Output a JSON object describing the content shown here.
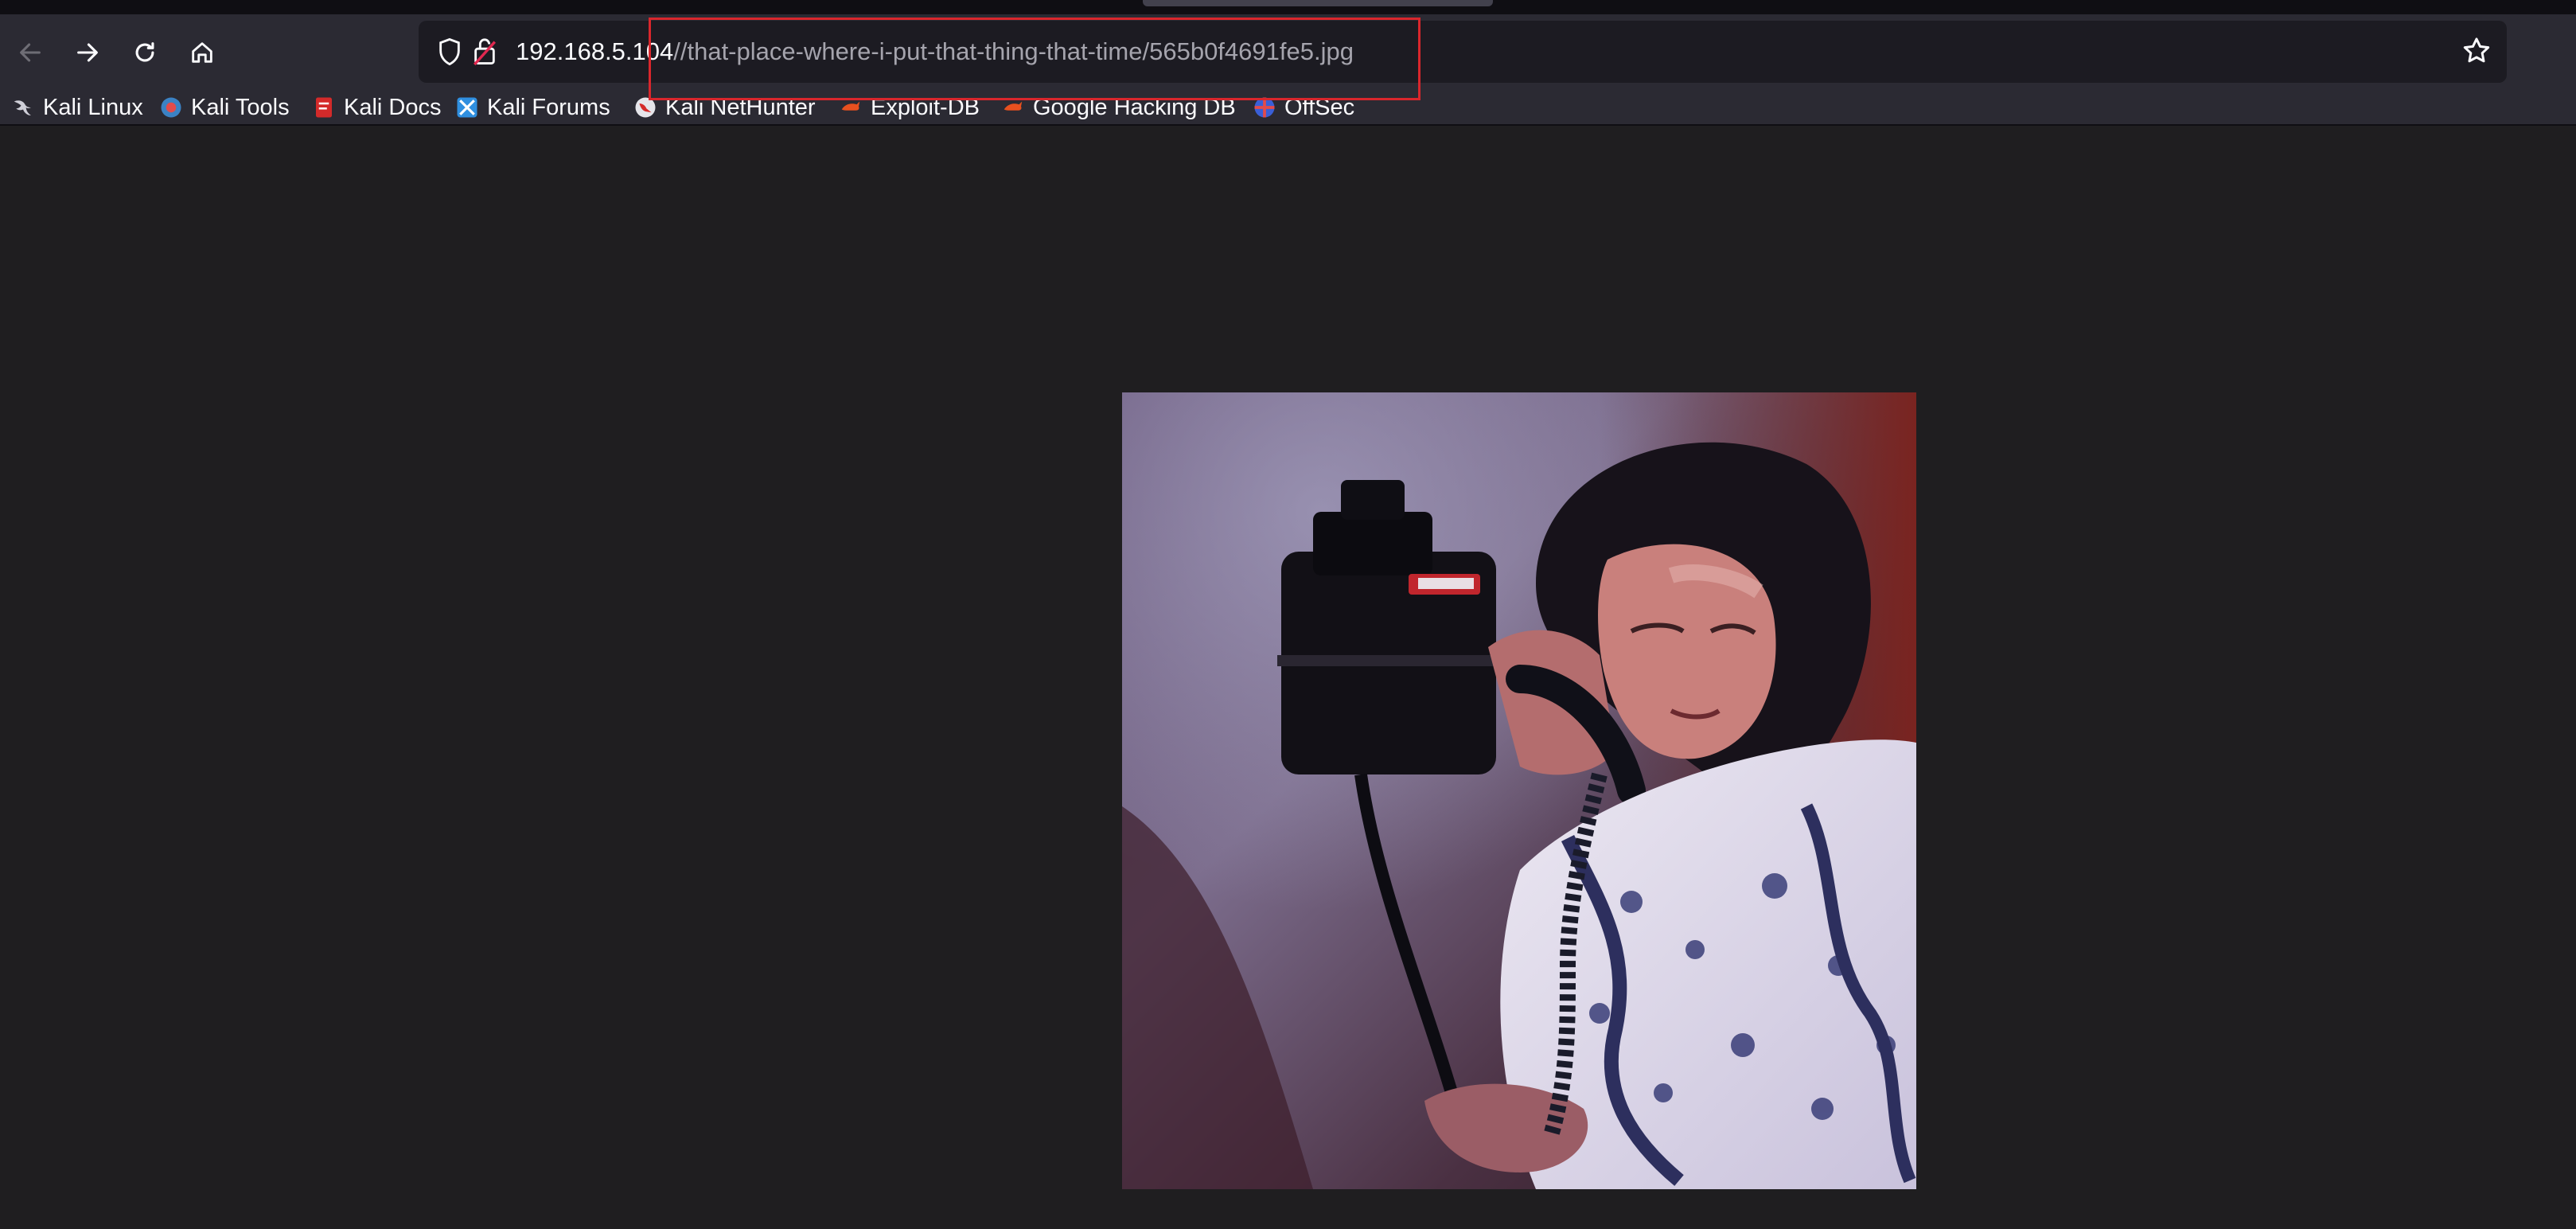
{
  "browser": {
    "url": {
      "host": "192.168.5.104",
      "path": "//that-place-where-i-put-that-thing-that-time/565b0f4691fe5.jpg"
    },
    "nav": {
      "back_icon": "arrow-left-icon",
      "forward_icon": "arrow-right-icon",
      "reload_icon": "reload-icon",
      "home_icon": "home-icon"
    },
    "bookmarks": [
      {
        "label": "Kali Linux",
        "icon": "kali-dragon-icon"
      },
      {
        "label": "Kali Tools",
        "icon": "kali-tools-icon"
      },
      {
        "label": "Kali Docs",
        "icon": "kali-docs-icon"
      },
      {
        "label": "Kali Forums",
        "icon": "kali-forums-icon"
      },
      {
        "label": "Kali NetHunter",
        "icon": "kali-nethunter-icon"
      },
      {
        "label": "Exploit-DB",
        "icon": "exploit-db-icon"
      },
      {
        "label": "Google Hacking DB",
        "icon": "exploit-db-icon"
      },
      {
        "label": "OffSec",
        "icon": "offsec-icon"
      }
    ]
  },
  "colors": {
    "toolbar": "#2b2a33",
    "urlbar": "#1c1b22",
    "page_background": "#1f1e20",
    "annotation": "#d9262c"
  },
  "viewer": {
    "image_description_icon": "photo-woman-on-payphone"
  }
}
